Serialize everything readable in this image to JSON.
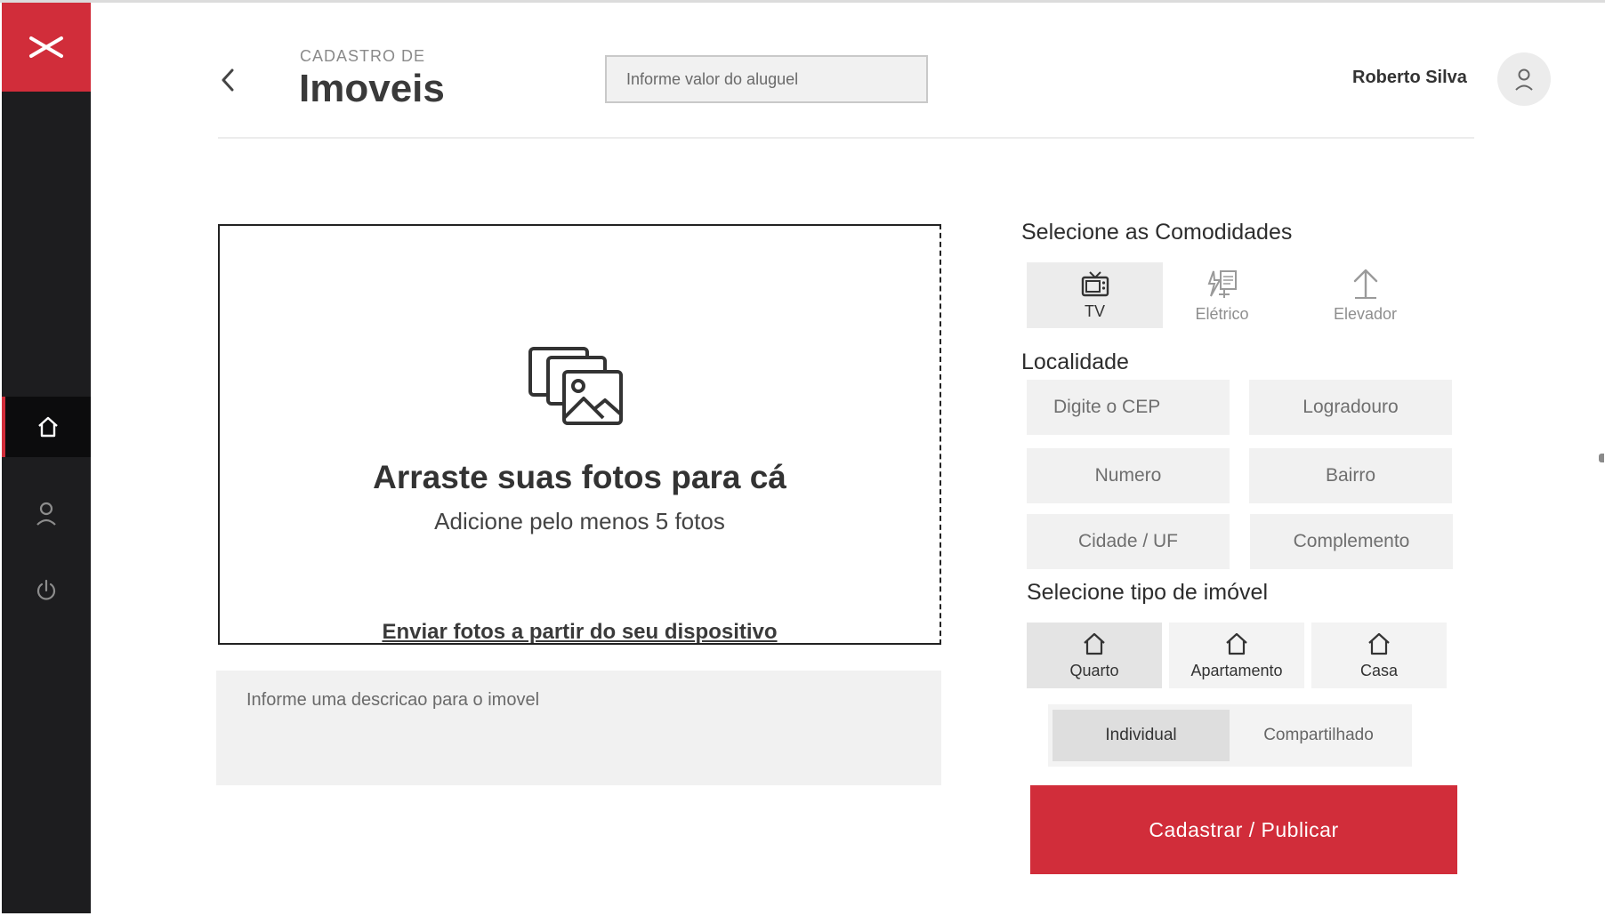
{
  "header": {
    "eyebrow": "CADASTRO DE",
    "title": "Imoveis",
    "rent_placeholder": "Informe valor do aluguel",
    "user_name": "Roberto Silva"
  },
  "upload": {
    "title": "Arraste suas fotos para cá",
    "subtitle": "Adicione pelo menos 5 fotos",
    "link": "Enviar fotos a partir do seu dispositivo"
  },
  "description_placeholder": "Informe uma descricao para o imovel",
  "amenities": {
    "title": "Selecione as Comodidades",
    "items": [
      {
        "label": "TV",
        "icon": "tv-icon",
        "selected": true
      },
      {
        "label": "Elétrico",
        "icon": "electric-icon",
        "selected": false
      },
      {
        "label": "Elevador",
        "icon": "elevator-icon",
        "selected": false
      }
    ]
  },
  "location": {
    "title": "Localidade",
    "cep": "Digite o CEP",
    "street": "Logradouro",
    "number": "Numero",
    "district": "Bairro",
    "city": "Cidade / UF",
    "complement": "Complemento"
  },
  "property_type": {
    "title": "Selecione tipo de imóvel",
    "items": [
      {
        "label": "Quarto",
        "icon": "house-icon",
        "selected": true
      },
      {
        "label": "Apartamento",
        "icon": "house-icon",
        "selected": false
      },
      {
        "label": "Casa",
        "icon": "house-icon",
        "selected": false
      }
    ],
    "sharing": [
      {
        "label": "Individual",
        "selected": true
      },
      {
        "label": "Compartilhado",
        "selected": false
      }
    ]
  },
  "submit_label": "Cadastrar / Publicar",
  "colors": {
    "brand": "#d12d3a",
    "sidebar": "#1d1d1f"
  }
}
